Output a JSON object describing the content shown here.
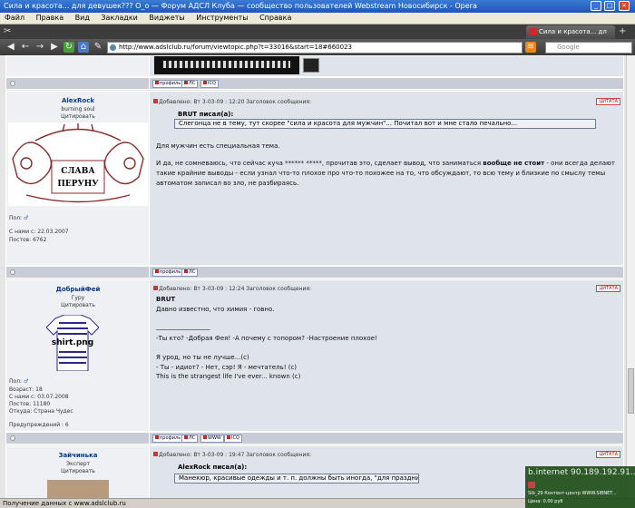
{
  "window": {
    "title": "Сила и красота... для девушек??? О_о — Форум АДСЛ Клуба — сообщество пользователей Webstream Новосибирск - Opera",
    "controls": [
      "_",
      "□",
      "×"
    ]
  },
  "menu": [
    "Файл",
    "Правка",
    "Вид",
    "Закладки",
    "Виджеты",
    "Инструменты",
    "Справка"
  ],
  "tab": {
    "label": "Сила и красота... дл"
  },
  "address": {
    "url": "http://www.adslclub.ru/forum/viewtopic.php?t=33016&start=18#660023",
    "search_placeholder": "Google"
  },
  "buttons": {
    "profile": "профиль",
    "pm": "ЛС",
    "www": "WWW",
    "icq": "ICQ",
    "quote": "ЦИТАТА"
  },
  "posts": [
    {
      "author": "AlexRock",
      "title": "burning soul",
      "quote_link": "Цитировать",
      "avatar_text_top": "СЛАВА",
      "avatar_text_bottom": "ПЕРУНУ",
      "gender": "Пол:",
      "joined": "С нами с: 22.03.2007",
      "posts": "Постов: 6762",
      "header": "Добавлено: Вт 3-03-09 : 12:20    Заголовок сообщения:",
      "quote_author": "BRUT писал(а):",
      "quote_text": "Слегонца не в тему, тут скорее \"сила и красота для мужчин\"... Почитал вот и мне стало печально...",
      "body1": "Для мужчин есть специальная тема.",
      "body2_pre": "И да, не сомневаюсь, что сейчас куча ****** *****, прочитав это, сделает вывод, что заниматься ",
      "body2_bold": "вообще не стоит",
      "body2_post": " - они всегда делают такие крайние выводы - если узнал что-то плохое про что-то похожее на то, что обсуждают, то всю тему и близкие по смыслу темы автоматом записал во зло, не разбираясь."
    },
    {
      "author": "ДобрыйФей",
      "title": "Гуру",
      "quote_link": "Цитировать",
      "avatar_caption": "shirt.png",
      "gender": "Пол:",
      "age": "Возраст: 18",
      "joined": "С нами с: 03.07.2008",
      "posts": "Постов: 11180",
      "from": "Откуда: Страна Чудес",
      "warnings": "Предупреждений : 6",
      "header": "Добавлено: Вт 3-03-09 : 12:24    Заголовок сообщения:",
      "lines": [
        "BRUT",
        "Давно известно, что химия - говно.",
        "_________________",
        "-Ты кто? -Добрая Фея! -А почему с топором? -Настроение плохое!",
        "Я урод, но ты не лучше...(с)",
        "- Ты - идиот? - Нет, сэр! Я - мечтатель! (с)",
        "This is the strangest life I've ever... known (c)"
      ]
    },
    {
      "author": "Зайчинька",
      "title": "Эксперт",
      "quote_link": "Цитировать",
      "header": "Добавлено: Вт 3-03-09 : 19:47    Заголовок сообщения:",
      "quote_author": "AlexRock писал(а):",
      "quote_text": "Манекюр, красивые одежды и т. п. должны быть иногда, \"для праздников\"."
    }
  ],
  "status": {
    "text": "Получение данных с www.adslclub.ru"
  },
  "notification": {
    "ip": "b.internet 90.189.192.91...",
    "line1": "Sib_29 Контент-центр WWW.SIBNET...",
    "line2": "Цена: 0.00 руб"
  }
}
